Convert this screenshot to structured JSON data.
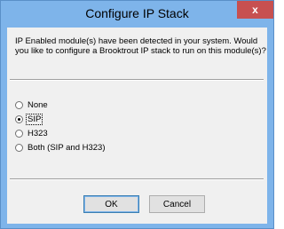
{
  "window": {
    "title": "Configure IP Stack",
    "close_glyph": "x"
  },
  "message": "IP Enabled module(s) have been detected in your system. Would you like to configure a Brooktrout IP stack to run on this module(s)?",
  "options": [
    {
      "label": "None",
      "checked": false
    },
    {
      "label": "SIP",
      "checked": true
    },
    {
      "label": "H323",
      "checked": false
    },
    {
      "label": "Both (SIP and H323)",
      "checked": false
    }
  ],
  "buttons": {
    "ok_label": "OK",
    "cancel_label": "Cancel"
  },
  "colors": {
    "titlebar": "#7eb4ea",
    "close_button": "#c75050",
    "client": "#f0f0f0"
  },
  "icons": {
    "close": "close-icon",
    "radio": "radio-icon"
  }
}
